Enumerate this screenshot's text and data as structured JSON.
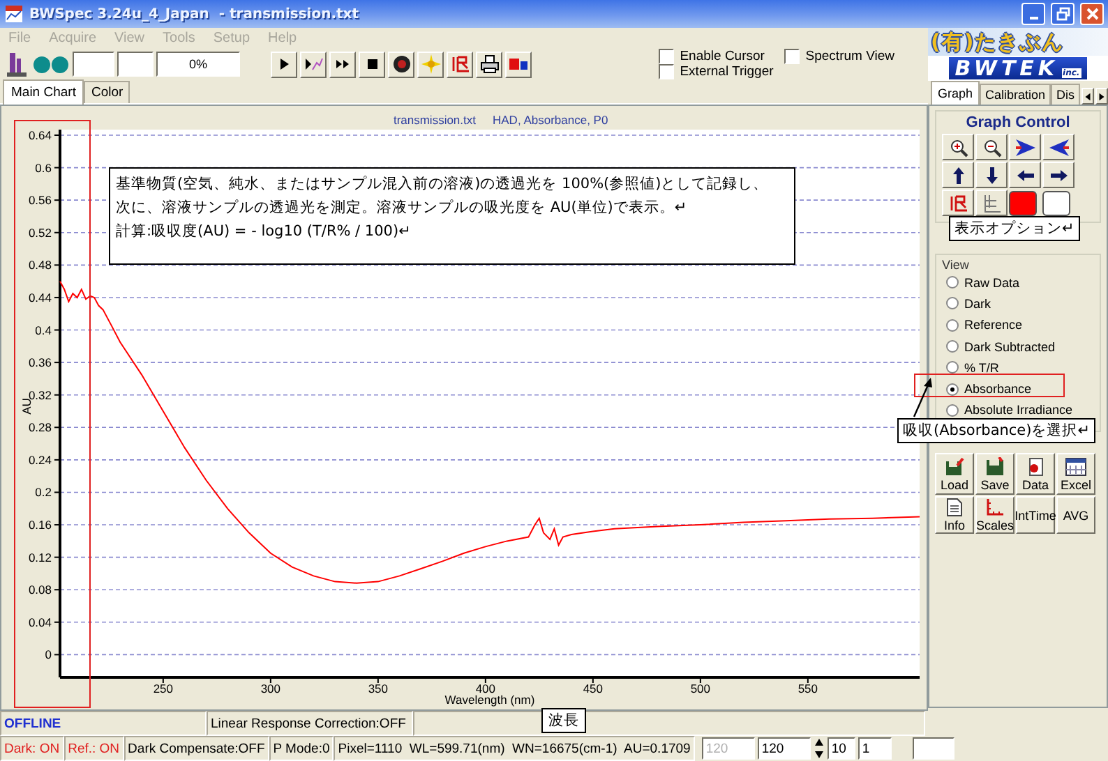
{
  "window": {
    "title": "BWSpec 3.24u_4_Japan  - transmission.txt"
  },
  "menu": [
    {
      "label": "File",
      "disabled": true
    },
    {
      "label": "Acquire",
      "disabled": true
    },
    {
      "label": "View",
      "disabled": true
    },
    {
      "label": "Tools",
      "disabled": true
    },
    {
      "label": "Setup",
      "disabled": true
    },
    {
      "label": "Help",
      "disabled": true
    }
  ],
  "brand": {
    "name": "(有)たきぶん",
    "logo": "BWTEK",
    "logo_suffix": "inc."
  },
  "toolbar": {
    "progress": "0%"
  },
  "options": [
    {
      "label": "Enable Cursor",
      "checked": false
    },
    {
      "label": "Spectrum View",
      "checked": false
    },
    {
      "label": "External Trigger",
      "checked": false
    }
  ],
  "chart_tabs": [
    {
      "label": "Main Chart",
      "selected": true
    },
    {
      "label": "Color",
      "selected": false
    }
  ],
  "chart": {
    "title": "transmission.txt",
    "subtitle": "HAD, Absorbance, P0",
    "chart_data": {
      "type": "line",
      "grid": true,
      "xlabel": "Wavelength (nm)",
      "ylabel": "AU",
      "xlim": [
        202,
        602
      ],
      "ylim": [
        -0.028,
        0.64
      ],
      "xticks": [
        250,
        300,
        350,
        400,
        450,
        500,
        550
      ],
      "yticks": [
        0,
        0.04,
        0.08,
        0.12,
        0.16,
        0.2,
        0.24,
        0.28,
        0.32,
        0.36,
        0.4,
        0.44,
        0.48,
        0.52,
        0.56,
        0.6,
        0.64
      ],
      "x": [
        202,
        204,
        206,
        208,
        210,
        212,
        214,
        216,
        218,
        220,
        222,
        226,
        230,
        240,
        250,
        260,
        270,
        280,
        290,
        300,
        310,
        320,
        330,
        340,
        350,
        360,
        370,
        380,
        390,
        400,
        410,
        420,
        423,
        425,
        427,
        430,
        432,
        434,
        436,
        440,
        450,
        460,
        480,
        500,
        520,
        540,
        560,
        580,
        602
      ],
      "series": [
        {
          "color": "#ff0000",
          "values": [
            0.46,
            0.45,
            0.435,
            0.445,
            0.44,
            0.45,
            0.438,
            0.442,
            0.44,
            0.43,
            0.425,
            0.405,
            0.385,
            0.345,
            0.3,
            0.255,
            0.215,
            0.18,
            0.15,
            0.125,
            0.108,
            0.097,
            0.09,
            0.088,
            0.09,
            0.097,
            0.106,
            0.115,
            0.125,
            0.133,
            0.14,
            0.145,
            0.16,
            0.168,
            0.15,
            0.142,
            0.155,
            0.135,
            0.145,
            0.148,
            0.152,
            0.155,
            0.158,
            0.16,
            0.163,
            0.165,
            0.167,
            0.168,
            0.17
          ]
        }
      ]
    }
  },
  "note": {
    "lines": [
      "基準物質(空気、純水、またはサンプル混入前の溶液)の透過光を 100%(参照値)として記録し、",
      "次に、溶液サンプルの透過光を測定。溶液サンプルの吸光度を AU(単位)で表示。↵",
      "計算:吸収度(AU) = - log10 (T/R% / 100)↵"
    ]
  },
  "side_tabs": [
    {
      "label": "Graph",
      "selected": true
    },
    {
      "label": "Calibration",
      "selected": false
    },
    {
      "label": "Dis",
      "selected": false
    }
  ],
  "graph_control": {
    "title": "Graph Control",
    "swatches": [
      {
        "color": "#ff0000"
      },
      {
        "color": "#ffffff"
      }
    ]
  },
  "view_options_callout": "表示オプション↵",
  "view": {
    "title": "View",
    "options": [
      {
        "label": "Raw Data",
        "selected": false
      },
      {
        "label": "Dark",
        "selected": false
      },
      {
        "label": "Reference",
        "selected": false
      },
      {
        "label": "Dark Subtracted",
        "selected": false
      },
      {
        "label": "% T/R",
        "selected": false
      },
      {
        "label": "Absorbance",
        "selected": true
      },
      {
        "label": "Absolute Irradiance",
        "selected": false
      }
    ]
  },
  "absorbance_callout": "吸収(Absorbance)を選択↵",
  "actions": [
    {
      "label": "Load",
      "kind": "load"
    },
    {
      "label": "Save",
      "kind": "save"
    },
    {
      "label": "Data",
      "kind": "data"
    },
    {
      "label": "Excel",
      "kind": "excel"
    },
    {
      "label": "Info",
      "kind": "info"
    },
    {
      "label": "Scales",
      "kind": "scales"
    },
    {
      "label": "IntTime",
      "kind": "text"
    },
    {
      "label": "AVG",
      "kind": "text"
    }
  ],
  "status": {
    "connection": "OFFLINE",
    "correction": "Linear Response Correction:OFF",
    "items": [
      {
        "text": "Dark: ON",
        "alert": true
      },
      {
        "text": "Ref.: ON",
        "alert": true
      },
      {
        "text": "Dark Compensate:OFF",
        "alert": false
      },
      {
        "text": "P Mode:0",
        "alert": false
      },
      {
        "text": "Pixel=1110  WL=599.71(nm)  WN=16675(cm-1)  AU=0.1709",
        "alert": false
      }
    ],
    "fields": [
      {
        "value": "120",
        "disabled": true
      },
      {
        "value": "120",
        "disabled": false
      }
    ],
    "spin_value": "10",
    "count": "1"
  },
  "wavelength_callout": "波長"
}
